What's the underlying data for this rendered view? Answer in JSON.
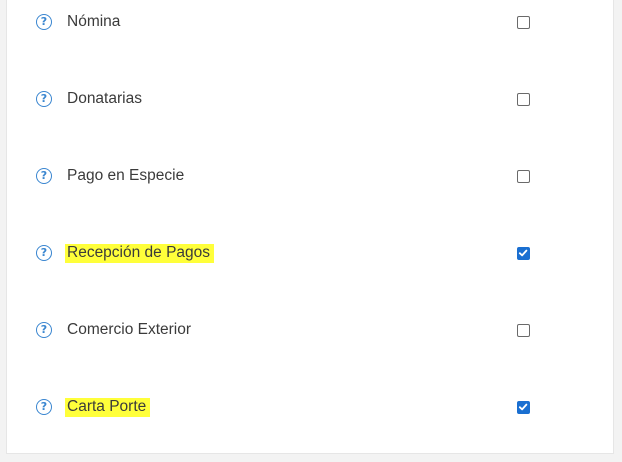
{
  "help_glyph": "?",
  "accent_color": "#1a6fd1",
  "highlight_color": "#ffff3a",
  "items": [
    {
      "label": "Nómina",
      "checked": false,
      "highlighted": false
    },
    {
      "label": "Donatarias",
      "checked": false,
      "highlighted": false
    },
    {
      "label": "Pago en Especie",
      "checked": false,
      "highlighted": false
    },
    {
      "label": "Recepción de Pagos",
      "checked": true,
      "highlighted": true
    },
    {
      "label": "Comercio Exterior",
      "checked": false,
      "highlighted": false
    },
    {
      "label": "Carta Porte",
      "checked": true,
      "highlighted": true
    }
  ]
}
